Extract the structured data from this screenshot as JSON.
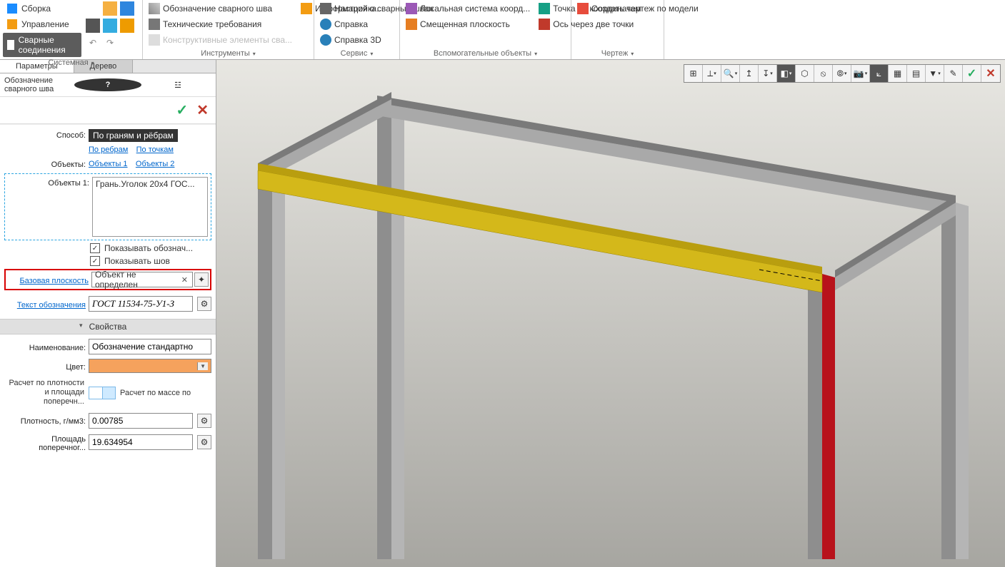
{
  "ribbon": {
    "side": {
      "assembly": "Сборка",
      "management": "Управление",
      "welds": "Сварные соединения"
    },
    "group_system": "Системная",
    "group_tools": "Инструменты",
    "tools": {
      "weld_symbol": "Обозначение сварного шва",
      "tech_req": "Технические требования",
      "construct": "Конструктивные элементы сва...",
      "weld_info": "Информация о сварных швах"
    },
    "group_service": "Сервис",
    "service": {
      "settings": "Настройка...",
      "help": "Справка",
      "help3d": "Справка 3D"
    },
    "group_aux": "Вспомогательные объекты",
    "aux": {
      "lcs": "Локальная система коорд...",
      "offset_plane": "Смещенная плоскость",
      "point_coord": "Точка по координатам",
      "axis_two": "Ось через две точки"
    },
    "group_drawing": "Чертеж",
    "drawing": {
      "create": "Создать чертеж по модели"
    }
  },
  "panel": {
    "tab_params": "Параметры",
    "tab_tree": "Дерево",
    "title": "Обозначение сварного шва",
    "method_label": "Способ:",
    "method_by_faces_edges": "По граням и рёбрам",
    "method_by_edges": "По ребрам",
    "method_by_points": "По точкам",
    "objects_label": "Объекты:",
    "objects1_link": "Объекты 1",
    "objects2_link": "Объекты 2",
    "objects1_label": "Объекты 1:",
    "objects1_item": "Грань.Уголок 20х4 ГОС...",
    "show_symbol": "Показывать обознач...",
    "show_weld": "Показывать шов",
    "base_plane_label": "Базовая плоскость",
    "base_plane_value": "Объект не определен",
    "text_symbol_label": "Текст обозначения",
    "text_symbol_value": "ГОСТ 11534-75-У1-З",
    "props_head": "Свойства",
    "name_label": "Наименование:",
    "name_value": "Обозначение стандартно",
    "color_label": "Цвет:",
    "calc_density_label": "Расчет по плотности и площади поперечн...",
    "calc_mass_label": "Расчет по массе по",
    "density_label": "Плотность, г/мм3:",
    "density_value": "0.00785",
    "area_label": "Площадь поперечног...",
    "area_value": "19.634954"
  },
  "colors": {
    "highlight_yellow": "#d4b81a",
    "highlight_red": "#b8121b",
    "steel": "#9a9a9a",
    "steel_dark": "#6f6f6f"
  }
}
